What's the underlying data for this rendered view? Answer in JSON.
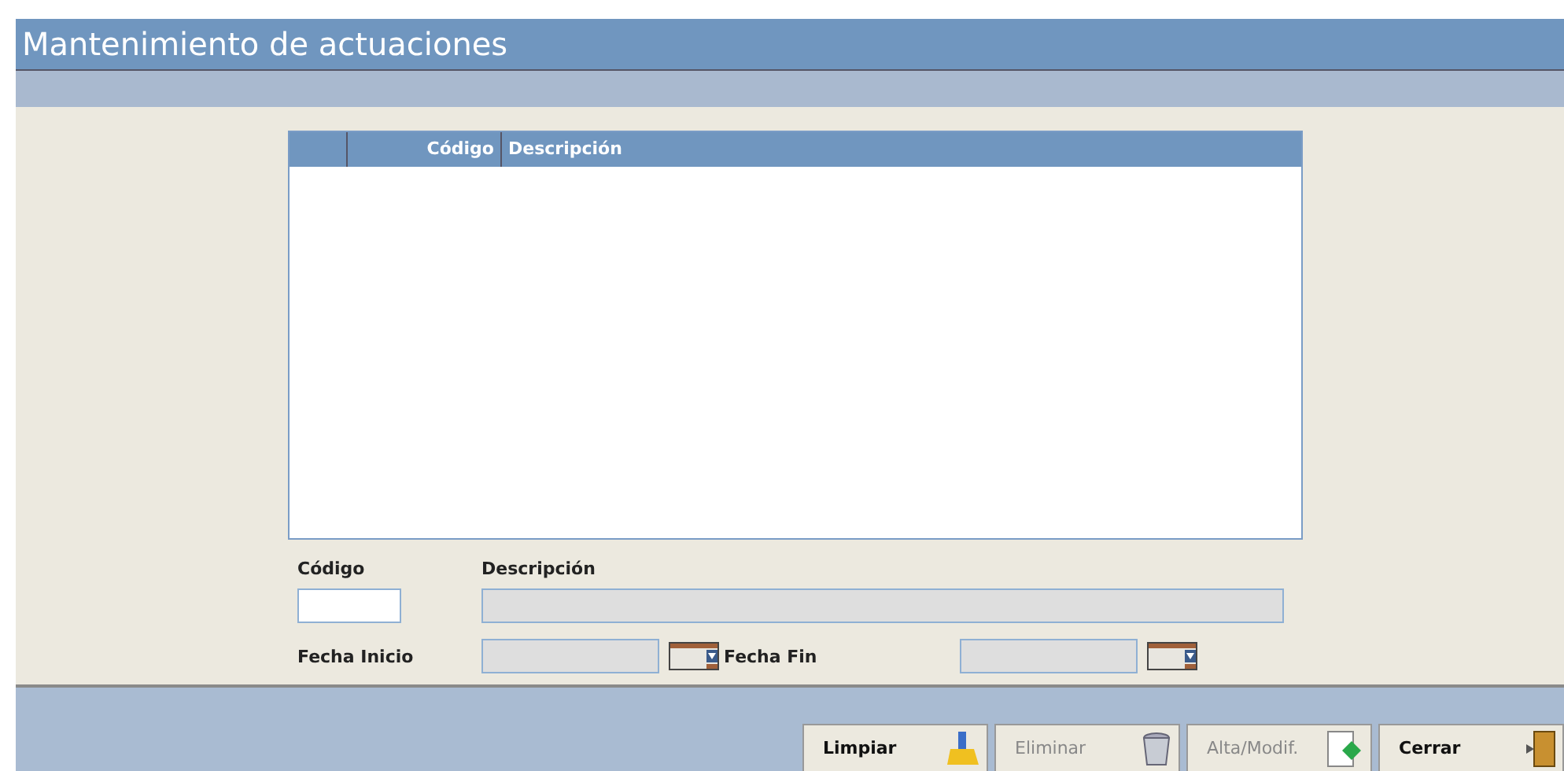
{
  "window": {
    "title": "Mantenimiento de actuaciones"
  },
  "table": {
    "columns": [
      {},
      {
        "label": "Código"
      },
      {
        "label": "Descripción"
      }
    ]
  },
  "form": {
    "codigo": {
      "label": "Código",
      "disabled": false
    },
    "descripcion": {
      "label": "Descripción",
      "disabled": true
    },
    "fecha_inicio": {
      "label": "Fecha Inicio",
      "disabled": true
    },
    "fecha_fin": {
      "label": "Fecha Fin",
      "disabled": true
    }
  },
  "buttons": [
    {
      "label": "Limpiar",
      "kind": "clear",
      "disabled": false
    },
    {
      "label": "Eliminar",
      "kind": "delete",
      "disabled": true
    },
    {
      "label": "Alta/Modif.",
      "kind": "save",
      "disabled": true
    },
    {
      "label": "Cerrar",
      "kind": "close",
      "disabled": false
    }
  ]
}
